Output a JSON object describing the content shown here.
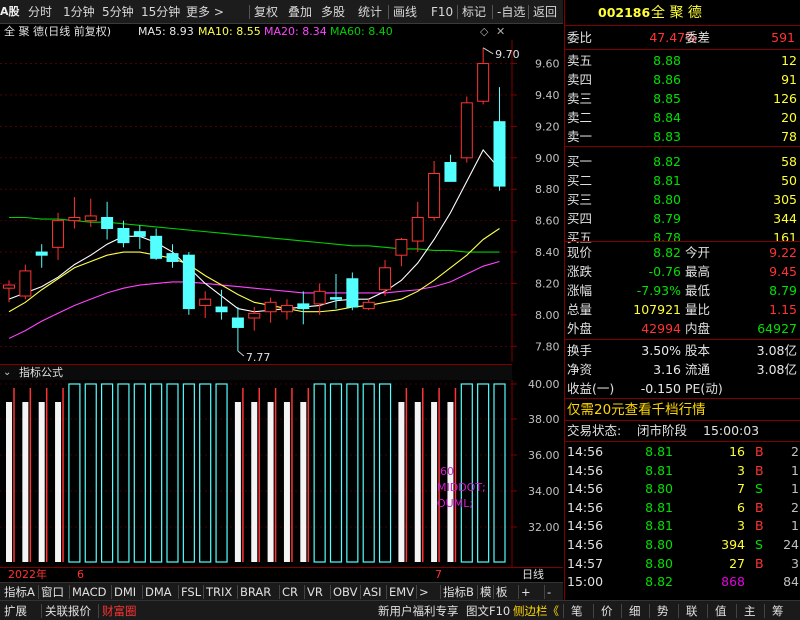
{
  "toolbar": {
    "logo": "A股",
    "items": [
      "分时",
      "1分钟",
      "5分钟",
      "15分钟",
      "更多 >",
      "复权",
      "叠加",
      "多股",
      "统计",
      "画线",
      "F10",
      "标记",
      "-自选",
      "返回"
    ]
  },
  "chart_header": {
    "title": "全 聚 德(日线 前复权)",
    "ma5": "MA5: 8.93",
    "ma10": "MA10: 8.55",
    "ma20": "MA20: 8.34",
    "ma60": "MA60: 8.40",
    "icons": [
      "diamond-icon",
      "close-icon"
    ]
  },
  "colors": {
    "up": "#ff3333",
    "down": "#54ffff",
    "ma5": "#ffffff",
    "ma10": "#ffff4c",
    "ma20": "#ff44ff",
    "ma60": "#00d000",
    "grid": "#800000",
    "axis": "#c0c0c0"
  },
  "price_axis": [
    "9.60",
    "9.40",
    "9.20",
    "9.00",
    "8.80",
    "8.60",
    "8.40",
    "8.20",
    "8.00",
    "7.80"
  ],
  "annotations": {
    "high": "9.70",
    "low": "7.77"
  },
  "chart_data": {
    "type": "candlestick",
    "ylim": [
      7.7,
      9.75
    ],
    "candles": [
      [
        8.17,
        8.22,
        8.08,
        8.19
      ],
      [
        8.12,
        8.32,
        8.1,
        8.28
      ],
      [
        8.4,
        8.45,
        8.3,
        8.38
      ],
      [
        8.43,
        8.65,
        8.35,
        8.6
      ],
      [
        8.6,
        8.75,
        8.55,
        8.62
      ],
      [
        8.6,
        8.74,
        8.56,
        8.63
      ],
      [
        8.62,
        8.72,
        8.48,
        8.55
      ],
      [
        8.55,
        8.6,
        8.43,
        8.46
      ],
      [
        8.53,
        8.57,
        8.42,
        8.5
      ],
      [
        8.5,
        8.55,
        8.35,
        8.36
      ],
      [
        8.39,
        8.45,
        8.3,
        8.34
      ],
      [
        8.38,
        8.4,
        8.0,
        8.04
      ],
      [
        8.06,
        8.15,
        7.98,
        8.1
      ],
      [
        8.05,
        8.16,
        7.97,
        8.02
      ],
      [
        7.98,
        8.05,
        7.77,
        7.92
      ],
      [
        7.98,
        8.05,
        7.9,
        8.01
      ],
      [
        8.02,
        8.11,
        7.95,
        8.08
      ],
      [
        8.02,
        8.1,
        7.97,
        8.06
      ],
      [
        8.07,
        8.15,
        7.94,
        8.04
      ],
      [
        8.07,
        8.2,
        8.0,
        8.15
      ],
      [
        8.11,
        8.26,
        8.04,
        8.1
      ],
      [
        8.23,
        8.27,
        8.03,
        8.05
      ],
      [
        8.04,
        8.1,
        8.03,
        8.08
      ],
      [
        8.16,
        8.35,
        8.12,
        8.3
      ],
      [
        8.38,
        8.49,
        8.31,
        8.48
      ],
      [
        8.47,
        8.72,
        8.4,
        8.62
      ],
      [
        8.62,
        8.98,
        8.6,
        8.9
      ],
      [
        8.97,
        9.02,
        8.85,
        8.85
      ],
      [
        9.0,
        9.39,
        8.97,
        9.35
      ],
      [
        9.36,
        9.7,
        9.34,
        9.6
      ],
      [
        9.23,
        9.45,
        8.79,
        8.82
      ]
    ],
    "ma5": [
      8.1,
      8.14,
      8.18,
      8.24,
      8.32,
      8.38,
      8.45,
      8.5,
      8.5,
      8.46,
      8.4,
      8.3,
      8.2,
      8.12,
      8.04,
      8.02,
      8.03,
      8.04,
      8.05,
      8.06,
      8.09,
      8.1,
      8.1,
      8.15,
      8.22,
      8.33,
      8.48,
      8.65,
      8.85,
      9.05,
      8.93
    ],
    "ma10": [
      8.02,
      8.08,
      8.16,
      8.23,
      8.3,
      8.34,
      8.38,
      8.4,
      8.4,
      8.38,
      8.36,
      8.32,
      8.25,
      8.19,
      8.13,
      8.08,
      8.06,
      8.04,
      8.02,
      8.02,
      8.03,
      8.05,
      8.06,
      8.08,
      8.1,
      8.15,
      8.22,
      8.3,
      8.38,
      8.48,
      8.55
    ],
    "ma20": [
      7.85,
      7.9,
      7.96,
      8.01,
      8.06,
      8.1,
      8.14,
      8.17,
      8.19,
      8.2,
      8.21,
      8.21,
      8.2,
      8.19,
      8.18,
      8.17,
      8.16,
      8.15,
      8.14,
      8.14,
      8.14,
      8.14,
      8.14,
      8.14,
      8.15,
      8.16,
      8.18,
      8.21,
      8.26,
      8.31,
      8.34
    ],
    "ma60": [
      8.62,
      8.62,
      8.61,
      8.61,
      8.6,
      8.59,
      8.59,
      8.58,
      8.57,
      8.56,
      8.55,
      8.54,
      8.53,
      8.52,
      8.51,
      8.5,
      8.49,
      8.48,
      8.47,
      8.46,
      8.45,
      8.44,
      8.44,
      8.43,
      8.42,
      8.42,
      8.41,
      8.41,
      8.4,
      8.4,
      8.4
    ]
  },
  "indicator": {
    "header": "指标公式",
    "axis": [
      "40.00",
      "38.00",
      "36.00",
      "34.00",
      "32.00"
    ],
    "legend": [
      "60",
      "MIDDOT;",
      "OUML;"
    ],
    "bars": [
      "w",
      "w",
      "w",
      "w",
      "c",
      "c",
      "c",
      "c",
      "c",
      "c",
      "c",
      "c",
      "c",
      "c",
      "w",
      "w",
      "w",
      "w",
      "w",
      "c",
      "c",
      "c",
      "c",
      "c",
      "w",
      "w",
      "w",
      "w",
      "c",
      "c",
      "c"
    ]
  },
  "datebar": {
    "year": "2022年",
    "m1": "6",
    "m2": "7",
    "right": "日线"
  },
  "tabs1": [
    "指标A",
    "窗口",
    "MACD",
    "DMI",
    "DMA",
    "FSL",
    "TRIX",
    "BRAR",
    "CR",
    "VR",
    "OBV",
    "ASI",
    "EMV",
    ">",
    "指标B",
    "模",
    "板",
    "+",
    "-"
  ],
  "tabs2": {
    "left": [
      "扩展",
      "关联报价",
      "财富圈"
    ],
    "promo": "新用户福利专享",
    "f10": "图文F10",
    "side": "侧边栏《",
    "right": [
      "笔",
      "价",
      "细",
      "势",
      "联",
      "值",
      "主",
      "筹"
    ]
  },
  "quote": {
    "code": "002186",
    "name": "全 聚 德",
    "weibi_label": "委比",
    "weibi": "47.47%",
    "weicha_label": "委差",
    "weicha": "591",
    "asks": [
      {
        "l": "卖五",
        "p": "8.88",
        "v": "12"
      },
      {
        "l": "卖四",
        "p": "8.86",
        "v": "91"
      },
      {
        "l": "卖三",
        "p": "8.85",
        "v": "126"
      },
      {
        "l": "卖二",
        "p": "8.84",
        "v": "20"
      },
      {
        "l": "卖一",
        "p": "8.83",
        "v": "78"
      }
    ],
    "bids": [
      {
        "l": "买一",
        "p": "8.82",
        "v": "58"
      },
      {
        "l": "买二",
        "p": "8.81",
        "v": "50"
      },
      {
        "l": "买三",
        "p": "8.80",
        "v": "305"
      },
      {
        "l": "买四",
        "p": "8.79",
        "v": "344"
      },
      {
        "l": "买五",
        "p": "8.78",
        "v": "161"
      }
    ],
    "stats": [
      {
        "l1": "现价",
        "v1": "8.82",
        "c1": "grn",
        "l2": "今开",
        "v2": "9.22",
        "c2": "red"
      },
      {
        "l1": "涨跌",
        "v1": "-0.76",
        "c1": "grn",
        "l2": "最高",
        "v2": "9.45",
        "c2": "red"
      },
      {
        "l1": "涨幅",
        "v1": "-7.93%",
        "c1": "grn",
        "l2": "最低",
        "v2": "8.79",
        "c2": "grn"
      },
      {
        "l1": "总量",
        "v1": "107921",
        "c1": "yel",
        "l2": "量比",
        "v2": "1.15",
        "c2": "red"
      },
      {
        "l1": "外盘",
        "v1": "42994",
        "c1": "red",
        "l2": "内盘",
        "v2": "64927",
        "c2": "grn"
      }
    ],
    "fin": [
      {
        "l1": "换手",
        "v1": "3.50%",
        "l2": "股本",
        "v2": "3.08亿"
      },
      {
        "l1": "净资",
        "v1": "3.16",
        "l2": "流通",
        "v2": "3.08亿"
      },
      {
        "l1": "收益(一)",
        "v1": "-0.150",
        "l2": "PE(动)",
        "v2": ""
      }
    ],
    "promo": "仅需20元查看千档行情",
    "status_label": "交易状态:",
    "status": "闭市阶段",
    "status_time": "15:00:03",
    "ticks": [
      {
        "t": "14:56",
        "p": "8.81",
        "v": "16",
        "s": "B",
        "n": "2"
      },
      {
        "t": "14:56",
        "p": "8.81",
        "v": "3",
        "s": "B",
        "n": "1"
      },
      {
        "t": "14:56",
        "p": "8.80",
        "v": "7",
        "s": "S",
        "n": "1"
      },
      {
        "t": "14:56",
        "p": "8.81",
        "v": "6",
        "s": "B",
        "n": "2"
      },
      {
        "t": "14:56",
        "p": "8.81",
        "v": "3",
        "s": "B",
        "n": "1"
      },
      {
        "t": "14:56",
        "p": "8.80",
        "v": "394",
        "s": "S",
        "n": "24"
      },
      {
        "t": "14:57",
        "p": "8.80",
        "v": "27",
        "s": "B",
        "n": "3"
      },
      {
        "t": "15:00",
        "p": "8.82",
        "v": "868",
        "s": "",
        "n": "84"
      }
    ]
  }
}
